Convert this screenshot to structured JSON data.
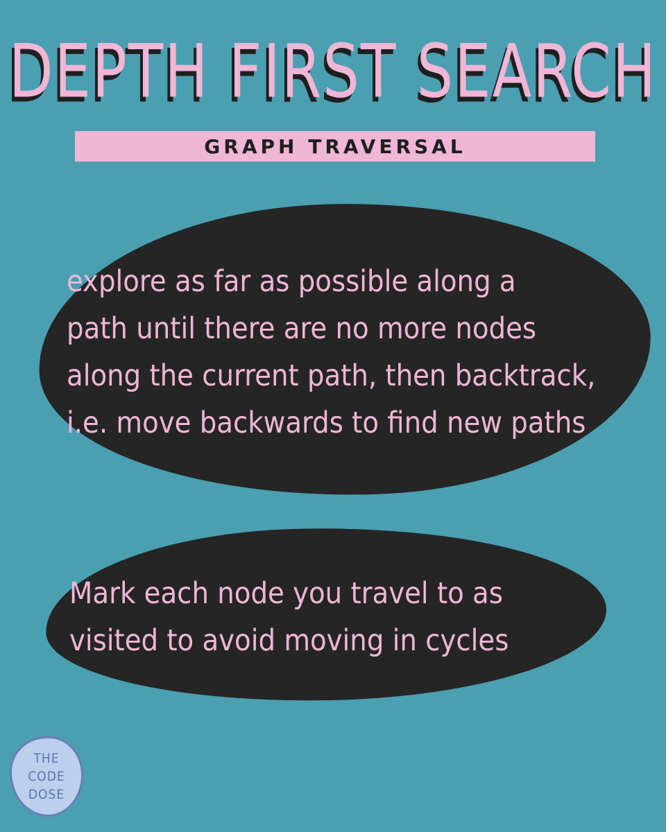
{
  "title": "DEPTH FIRST SEARCH",
  "subtitle": "GRAPH TRAVERSAL",
  "block1": {
    "lines": [
      "explore as far as possible along a",
      "path until there are no more nodes",
      "along the current path, then backtrack,",
      "i.e. move backwards to find new paths"
    ]
  },
  "block2": {
    "lines": [
      "Mark each node you travel to as",
      "visited to avoid moving in cycles"
    ]
  },
  "logo": {
    "lines": [
      "THE",
      "CODE",
      "DOSE"
    ]
  },
  "colors": {
    "background": "#4a9fb1",
    "pink": "#efb6d6",
    "dark": "#252525",
    "logo_fill": "#bcd0ee",
    "logo_text": "#5c74b4"
  }
}
